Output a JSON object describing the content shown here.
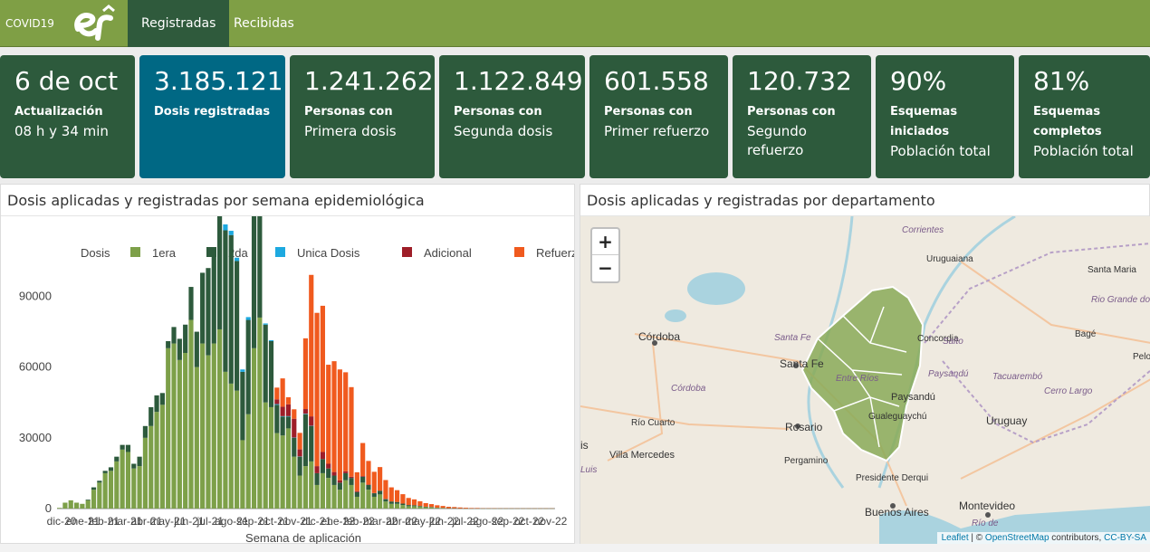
{
  "nav": {
    "brand": "COVID19",
    "tabs": [
      {
        "label": "Registradas"
      },
      {
        "label": "Recibidas"
      }
    ]
  },
  "cards": [
    {
      "value": "6 de oct",
      "label": "Actualización",
      "sub": "08 h y 34 min"
    },
    {
      "value": "3.185.121",
      "label": "Dosis registradas",
      "sub": ""
    },
    {
      "value": "1.241.262",
      "label": "Personas con",
      "sub": "Primera dosis"
    },
    {
      "value": "1.122.849",
      "label": "Personas con",
      "sub": "Segunda dosis"
    },
    {
      "value": "601.558",
      "label": "Personas con",
      "sub": "Primer refuerzo"
    },
    {
      "value": "120.732",
      "label": "Personas con",
      "sub": "Segundo refuerzo"
    },
    {
      "value": "90%",
      "label": "Esquemas iniciados",
      "sub": "Población total"
    },
    {
      "value": "81%",
      "label": "Esquemas completos",
      "sub": "Población total"
    }
  ],
  "chart_panel": {
    "title": "Dosis aplicadas y registradas por semana epidemiológica"
  },
  "map_panel": {
    "title": "Dosis aplicadas y registradas por departamento",
    "zoom_in": "+",
    "zoom_out": "−",
    "labels": [
      {
        "text": "Corrientes",
        "italic": true
      },
      {
        "text": "Uruguaiana",
        "italic": false
      },
      {
        "text": "Santa Maria",
        "italic": false
      },
      {
        "text": "Rio Grande do Sul",
        "italic": true
      },
      {
        "text": "Bagé",
        "italic": false
      },
      {
        "text": "Concordia",
        "italic": false
      },
      {
        "text": "Salto",
        "italic": true
      },
      {
        "text": "Córdoba",
        "italic": false
      },
      {
        "text": "Santa Fe",
        "italic": true
      },
      {
        "text": "Santa Fe",
        "italic": false
      },
      {
        "text": "Entre Ríos",
        "italic": true
      },
      {
        "text": "Paysandú",
        "italic": true
      },
      {
        "text": "Tacuarembó",
        "italic": true
      },
      {
        "text": "Cerro Largo",
        "italic": true
      },
      {
        "text": "Paysandú",
        "italic": false
      },
      {
        "text": "Córdoba",
        "italic": true
      },
      {
        "text": "Gualeguaychú",
        "italic": false
      },
      {
        "text": "Uruguay",
        "italic": false
      },
      {
        "text": "Río Cuarto",
        "italic": false
      },
      {
        "text": "Rosario",
        "italic": false
      },
      {
        "text": "Villa Mercedes",
        "italic": false
      },
      {
        "text": "Pergamino",
        "italic": false
      },
      {
        "text": "Presidente Derqui",
        "italic": false
      },
      {
        "text": "Buenos Aires",
        "italic": false
      },
      {
        "text": "Montevideo",
        "italic": false
      },
      {
        "text": "Pelo",
        "italic": false
      },
      {
        "text": "Luis",
        "italic": true
      },
      {
        "text": "is",
        "italic": false
      },
      {
        "text": "Río de",
        "italic": true
      }
    ],
    "attribution": {
      "leaflet": "Leaflet",
      "sep": " | © ",
      "osm": "OpenStreetMap",
      "mid": " contributors, ",
      "license": "CC-BY-SA"
    }
  },
  "colors": {
    "primera": "#7da049",
    "segunda": "#2d5a3c",
    "unica": "#1da9e0",
    "adicional": "#9e1e28",
    "refuerzo": "#f05a1e",
    "map_region_fill": "#8aaa58",
    "map_region_border": "#ffffff",
    "header_green": "#7f9f45",
    "card_green": "#2d5a3c",
    "card_blue": "#006884"
  },
  "chart_data": {
    "type": "bar",
    "stacked": true,
    "legend_title": "Dosis",
    "legend_position": "top",
    "xlabel": "Semana de aplicación",
    "ylabel": "",
    "ylim": [
      0,
      104000
    ],
    "yticks": [
      0,
      30000,
      60000,
      90000
    ],
    "grid": false,
    "xtick_labels": [
      "dic-20",
      "ene-21",
      "feb-21",
      "mar-21",
      "abr-21",
      "may-21",
      "jun-21",
      "jul-21",
      "ago-21",
      "sep-21",
      "oct-21",
      "nov-21",
      "dic-21",
      "ene-22",
      "feb-22",
      "mar-22",
      "abr-22",
      "may-22",
      "jun-22",
      "jul-22",
      "ago-22",
      "sep-22",
      "oct-22",
      "nov-22"
    ],
    "series": [
      {
        "name": "1era",
        "values": [
          300,
          2500,
          3500,
          2500,
          2000,
          3500,
          8000,
          11000,
          15000,
          16000,
          20000,
          25000,
          24000,
          17000,
          18000,
          30000,
          35000,
          41000,
          44000,
          68000,
          70000,
          63000,
          66000,
          80000,
          60000,
          70000,
          65000,
          70000,
          76000,
          58000,
          53000,
          50000,
          29000,
          40000,
          68000,
          81000,
          45000,
          43000,
          32000,
          31000,
          34000,
          22000,
          14000,
          18000,
          20000,
          10000,
          15000,
          13000,
          10000,
          8000,
          12000,
          10000,
          5000,
          11000,
          8000,
          5000,
          6000,
          3000,
          2000,
          2000,
          1500,
          1000,
          1000,
          800,
          600,
          500,
          300,
          200,
          100,
          100,
          50,
          20,
          20,
          20,
          20,
          20,
          20,
          20,
          20,
          20,
          20,
          20,
          20,
          20,
          20,
          20,
          20
        ]
      },
      {
        "name": "2da",
        "values": [
          0,
          0,
          0,
          0,
          0,
          300,
          1000,
          800,
          1000,
          1500,
          2000,
          2000,
          3000,
          2000,
          4000,
          5000,
          8000,
          7000,
          5000,
          3000,
          7000,
          9000,
          12000,
          14000,
          15000,
          30000,
          37000,
          40000,
          54000,
          60000,
          63000,
          55000,
          29000,
          40000,
          62000,
          52000,
          33000,
          28000,
          12000,
          8000,
          5000,
          8000,
          8000,
          22000,
          15000,
          5000,
          6000,
          4000,
          4000,
          3000,
          3000,
          3000,
          2000,
          2500,
          2000,
          1500,
          1500,
          1000,
          1000,
          800,
          600,
          500,
          400,
          300,
          200,
          200,
          100,
          100,
          50,
          50,
          20,
          20,
          20,
          20,
          20,
          20,
          20,
          20,
          20,
          20,
          20,
          20,
          20,
          20,
          20,
          20,
          20
        ]
      },
      {
        "name": "Unica Dosis",
        "values": [
          0,
          0,
          0,
          0,
          0,
          0,
          0,
          0,
          0,
          0,
          0,
          0,
          0,
          0,
          0,
          0,
          0,
          0,
          0,
          0,
          0,
          0,
          0,
          0,
          0,
          0,
          0,
          0,
          0,
          2500,
          1800,
          1400,
          1000,
          1200,
          800,
          600,
          500,
          400,
          300,
          200,
          200,
          100,
          100,
          200,
          100,
          0,
          0,
          0,
          0,
          0,
          0,
          0,
          0,
          0,
          0,
          0,
          0,
          0,
          0,
          0,
          0,
          0,
          0,
          0,
          0,
          0,
          0,
          0,
          0,
          0,
          0,
          0,
          0,
          0,
          0,
          0,
          0,
          0,
          0,
          0,
          0,
          0,
          0,
          0,
          0,
          0,
          0
        ]
      },
      {
        "name": "Adicional",
        "values": [
          0,
          0,
          0,
          0,
          0,
          0,
          0,
          0,
          0,
          0,
          0,
          0,
          0,
          0,
          0,
          0,
          0,
          0,
          0,
          0,
          0,
          0,
          0,
          0,
          0,
          0,
          0,
          0,
          0,
          0,
          0,
          0,
          0,
          0,
          0,
          0,
          0,
          0,
          2000,
          4000,
          5000,
          8000,
          3000,
          2000,
          4000,
          3000,
          3000,
          2000,
          1500,
          1000,
          800,
          500,
          400,
          300,
          200,
          100,
          100,
          100,
          0,
          0,
          0,
          0,
          0,
          0,
          0,
          0,
          0,
          0,
          0,
          0,
          0,
          0,
          0,
          0,
          0,
          0,
          0,
          0,
          0,
          0,
          0,
          0,
          0,
          0,
          0,
          0,
          0
        ]
      },
      {
        "name": "Refuerzo",
        "values": [
          0,
          0,
          0,
          0,
          0,
          0,
          0,
          0,
          0,
          0,
          0,
          0,
          0,
          0,
          0,
          0,
          0,
          0,
          0,
          0,
          0,
          0,
          0,
          0,
          0,
          0,
          0,
          0,
          0,
          0,
          0,
          0,
          0,
          0,
          0,
          0,
          0,
          0,
          5000,
          12000,
          3000,
          4000,
          7000,
          30000,
          60000,
          65000,
          62000,
          42000,
          47000,
          47000,
          42000,
          38000,
          8000,
          14000,
          10000,
          9000,
          10000,
          8000,
          6000,
          5000,
          4000,
          3000,
          2500,
          2000,
          1500,
          1200,
          1000,
          800,
          600,
          500,
          400,
          300,
          200,
          200,
          100,
          100,
          100,
          50,
          50,
          50,
          20,
          20,
          20,
          20,
          20,
          20,
          20
        ]
      }
    ]
  }
}
